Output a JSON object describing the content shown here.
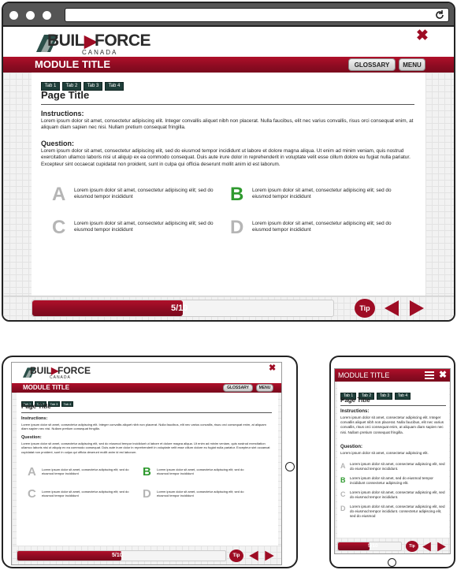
{
  "brand": {
    "name_part1": "BUIL",
    "name_part2": "FORCE",
    "subtitle": "CANADA"
  },
  "module_title": "MODULE TITLE",
  "buttons": {
    "glossary": "GLOSSARY",
    "menu": "MENU",
    "tip": "Tip"
  },
  "tabs": [
    "Tab 1",
    "Tab 2",
    "Tab 3",
    "Tab 4"
  ],
  "page_title": "Page Title",
  "instructions": {
    "heading": "Instructions:",
    "text": "Lorem ipsum dolor sit amet, consectetur adipiscing elit. Integer convallis aliquet nibh non placerat. Nulla faucibus, elit nec varius convallis, risus orci consequat enim, at aliquam diam sapien nec nisi. Nullam pretium consequat fringilla."
  },
  "question": {
    "heading": "Question:",
    "text": "Lorem ipsum dolor sit amet, consectetur adipiscing elit, sed do eiusmod tempor incididunt ut labore et dolore magna aliqua. Ut enim ad minim veniam, quis nostrud exercitation ullamco laboris nisi ut aliquip ex ea commodo consequat. Duis aute irure dolor in reprehenderit in voluptate velit esse cillum dolore eu fugiat nulla pariatur. Excepteur sint occaecat cupidatat non proident, sunt in culpa qui officia deserunt mollit anim id est laborum.",
    "mobile_text": "Lorem ipsum dolor sit amet, consectetur adipiscing elit."
  },
  "answers": [
    {
      "letter": "A",
      "text": "Lorem ipsum dolor sit amet, consectetur adipiscing elit; sed do eiusmod tempor incididunt",
      "state": "default"
    },
    {
      "letter": "B",
      "text": "Lorem ipsum dolor sit amet, consectetur adipiscing elit; sed do eiusmod tempor incididunt",
      "state": "correct"
    },
    {
      "letter": "C",
      "text": "Lorem ipsum dolor sit amet, consectetur adipiscing elit; sed do eiusmod tempor incididunt",
      "state": "default"
    },
    {
      "letter": "D",
      "text": "Lorem ipsum dolor sit amet, consectetur adipiscing elit; sed do eiusmod tempor incididunt",
      "state": "default"
    }
  ],
  "mobile_answers": [
    {
      "letter": "A",
      "text": "Lorem ipsum dolor sit amet, consectetur adipiscing elit, sed do eiusmod tempor incididunt."
    },
    {
      "letter": "B",
      "text": "Lorem ipsum dolor sit amet, sed do eiusmod tempor incididunt consectetur adipiscing elit."
    },
    {
      "letter": "C",
      "text": "Lorem ipsum dolor sit amet, consectetur adipiscing elit, sed do eiusmod tempor incididunt."
    },
    {
      "letter": "D",
      "text": "Lorem ipsum dolor sit amet, consectetur adipiscing elit, sed do eiusmod tempor incididunt. consectetur adipiscing elit, sed do eiusmod"
    }
  ],
  "progress": {
    "label": "5/10",
    "current": 5,
    "total": 10
  },
  "colors": {
    "brand_maroon": "#9e0c24",
    "tab_green": "#1f3f3a",
    "correct_green": "#2f9a2f"
  },
  "icons": {
    "close": "close-x-icon",
    "refresh": "refresh-icon",
    "prev": "prev-arrow-icon",
    "next": "next-arrow-icon",
    "hamburger": "hamburger-icon"
  }
}
